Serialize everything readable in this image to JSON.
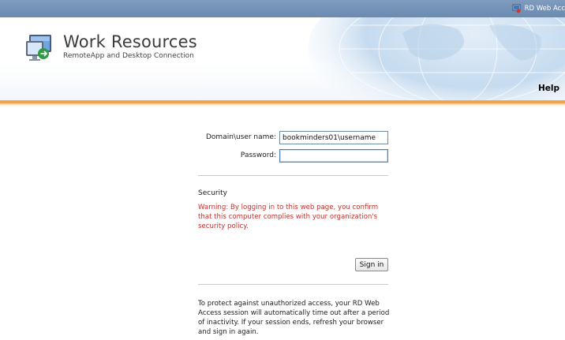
{
  "topbar": {
    "right_label": "RD Web Acc"
  },
  "header": {
    "title": "Work Resources",
    "subtitle": "RemoteApp and Desktop Connection",
    "help_label": "Help",
    "logo_icon": "remote-desktop-icon"
  },
  "login": {
    "username_label": "Domain\\user name:",
    "username_value": "bookminders01\\username",
    "password_label": "Password:",
    "password_value": "",
    "security_title": "Security",
    "warning": "Warning: By logging in to this web page, you confirm that this computer complies with your organization's security policy.",
    "signin_label": "Sign in",
    "timeout_notice": "To protect against unauthorized access, your RD Web Access session will automatically time out after a period of inactivity. If your session ends, refresh your browser and sign in again."
  },
  "colors": {
    "topbar": "#7f9cbf",
    "accent_orange": "#ef9a38",
    "warning_red": "#c0322e"
  }
}
